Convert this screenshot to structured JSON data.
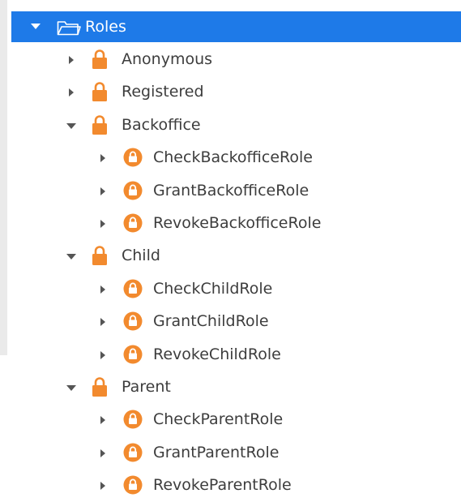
{
  "tree": {
    "root": {
      "label": "Roles",
      "icon": "folder-icon",
      "expanded": true
    },
    "roles": [
      {
        "label": "Anonymous",
        "icon": "lock-icon",
        "expanded": false,
        "children": []
      },
      {
        "label": "Registered",
        "icon": "lock-icon",
        "expanded": false,
        "children": []
      },
      {
        "label": "Backoffice",
        "icon": "lock-icon",
        "expanded": true,
        "children": [
          {
            "label": "CheckBackofficeRole",
            "icon": "lock-action-icon"
          },
          {
            "label": "GrantBackofficeRole",
            "icon": "lock-action-icon"
          },
          {
            "label": "RevokeBackofficeRole",
            "icon": "lock-action-icon"
          }
        ]
      },
      {
        "label": "Child",
        "icon": "lock-icon",
        "expanded": true,
        "children": [
          {
            "label": "CheckChildRole",
            "icon": "lock-action-icon"
          },
          {
            "label": "GrantChildRole",
            "icon": "lock-action-icon"
          },
          {
            "label": "RevokeChildRole",
            "icon": "lock-action-icon"
          }
        ]
      },
      {
        "label": "Parent",
        "icon": "lock-icon",
        "expanded": true,
        "children": [
          {
            "label": "CheckParentRole",
            "icon": "lock-action-icon"
          },
          {
            "label": "GrantParentRole",
            "icon": "lock-action-icon"
          },
          {
            "label": "RevokeParentRole",
            "icon": "lock-action-icon"
          }
        ]
      }
    ]
  },
  "colors": {
    "selection": "#1e7ae8",
    "lock": "#f28a2e",
    "text": "#3d3d3d"
  }
}
